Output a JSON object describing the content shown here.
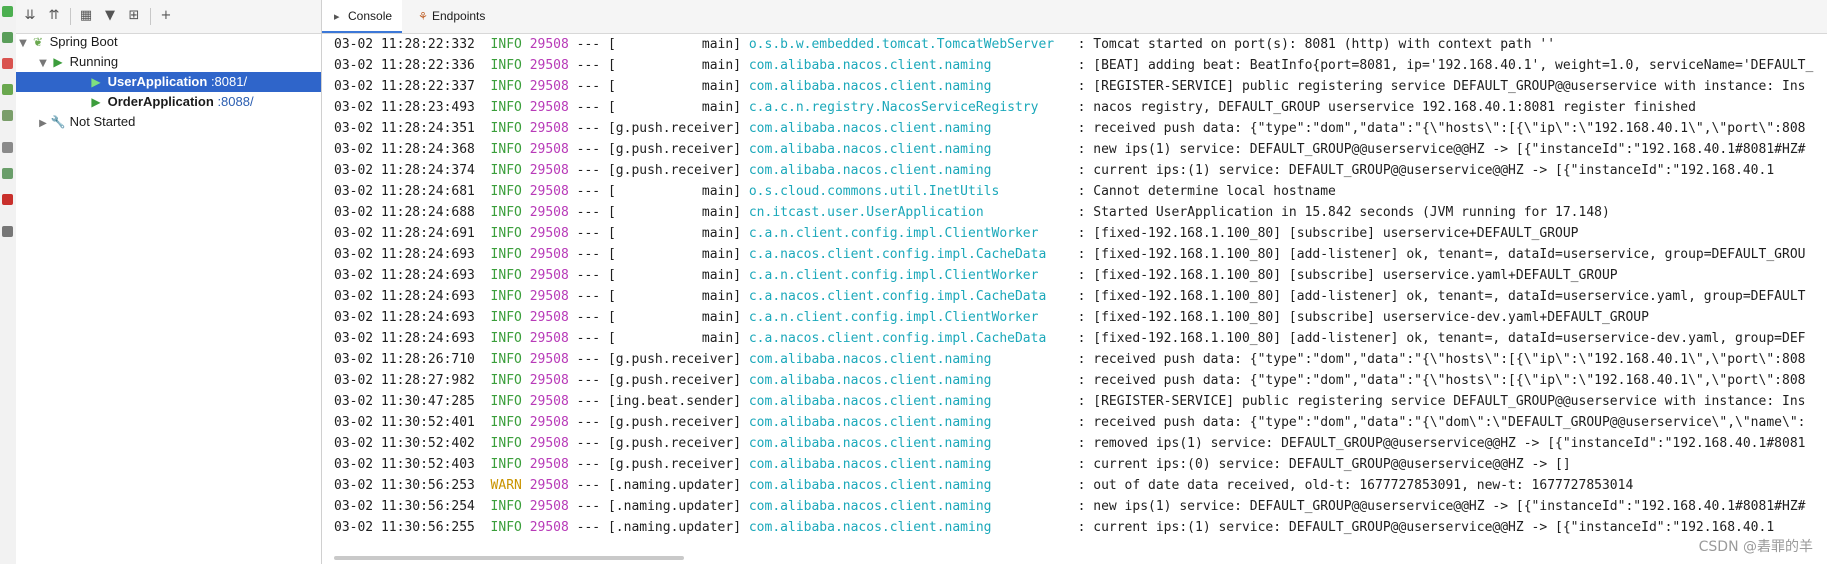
{
  "tree": {
    "root_label": "Spring Boot",
    "running_label": "Running",
    "apps": [
      {
        "name": "UserApplication",
        "port": ":8081/"
      },
      {
        "name": "OrderApplication",
        "port": ":8088/"
      }
    ],
    "not_started_label": "Not Started"
  },
  "tabs": {
    "console": "Console",
    "endpoints": "Endpoints"
  },
  "log": [
    {
      "ts": "03-02 11:28:22:332",
      "level": "INFO",
      "pid": "29508",
      "thread": "[           main]",
      "logger": "o.s.b.w.embedded.tomcat.TomcatWebServer  ",
      "msg": ": Tomcat started on port(s): 8081 (http) with context path ''"
    },
    {
      "ts": "03-02 11:28:22:336",
      "level": "INFO",
      "pid": "29508",
      "thread": "[           main]",
      "logger": "com.alibaba.nacos.client.naming          ",
      "msg": ": [BEAT] adding beat: BeatInfo{port=8081, ip='192.168.40.1', weight=1.0, serviceName='DEFAULT_"
    },
    {
      "ts": "03-02 11:28:22:337",
      "level": "INFO",
      "pid": "29508",
      "thread": "[           main]",
      "logger": "com.alibaba.nacos.client.naming          ",
      "msg": ": [REGISTER-SERVICE] public registering service DEFAULT_GROUP@@userservice with instance: Ins"
    },
    {
      "ts": "03-02 11:28:23:493",
      "level": "INFO",
      "pid": "29508",
      "thread": "[           main]",
      "logger": "c.a.c.n.registry.NacosServiceRegistry    ",
      "msg": ": nacos registry, DEFAULT_GROUP userservice 192.168.40.1:8081 register finished"
    },
    {
      "ts": "03-02 11:28:24:351",
      "level": "INFO",
      "pid": "29508",
      "thread": "[g.push.receiver]",
      "logger": "com.alibaba.nacos.client.naming          ",
      "msg": ": received push data: {\"type\":\"dom\",\"data\":\"{\\\"hosts\\\":[{\\\"ip\\\":\\\"192.168.40.1\\\",\\\"port\\\":808"
    },
    {
      "ts": "03-02 11:28:24:368",
      "level": "INFO",
      "pid": "29508",
      "thread": "[g.push.receiver]",
      "logger": "com.alibaba.nacos.client.naming          ",
      "msg": ": new ips(1) service: DEFAULT_GROUP@@userservice@@HZ -> [{\"instanceId\":\"192.168.40.1#8081#HZ#"
    },
    {
      "ts": "03-02 11:28:24:374",
      "level": "INFO",
      "pid": "29508",
      "thread": "[g.push.receiver]",
      "logger": "com.alibaba.nacos.client.naming          ",
      "msg": ": current ips:(1) service: DEFAULT_GROUP@@userservice@@HZ -> [{\"instanceId\":\"192.168.40.1"
    },
    {
      "ts": "03-02 11:28:24:681",
      "level": "INFO",
      "pid": "29508",
      "thread": "[           main]",
      "logger": "o.s.cloud.commons.util.InetUtils         ",
      "msg": ": Cannot determine local hostname"
    },
    {
      "ts": "03-02 11:28:24:688",
      "level": "INFO",
      "pid": "29508",
      "thread": "[           main]",
      "logger": "cn.itcast.user.UserApplication           ",
      "msg": ": Started UserApplication in 15.842 seconds (JVM running for 17.148)"
    },
    {
      "ts": "03-02 11:28:24:691",
      "level": "INFO",
      "pid": "29508",
      "thread": "[           main]",
      "logger": "c.a.n.client.config.impl.ClientWorker    ",
      "msg": ": [fixed-192.168.1.100_80] [subscribe] userservice+DEFAULT_GROUP"
    },
    {
      "ts": "03-02 11:28:24:693",
      "level": "INFO",
      "pid": "29508",
      "thread": "[           main]",
      "logger": "c.a.nacos.client.config.impl.CacheData   ",
      "msg": ": [fixed-192.168.1.100_80] [add-listener] ok, tenant=, dataId=userservice, group=DEFAULT_GROU"
    },
    {
      "ts": "03-02 11:28:24:693",
      "level": "INFO",
      "pid": "29508",
      "thread": "[           main]",
      "logger": "c.a.n.client.config.impl.ClientWorker    ",
      "msg": ": [fixed-192.168.1.100_80] [subscribe] userservice.yaml+DEFAULT_GROUP"
    },
    {
      "ts": "03-02 11:28:24:693",
      "level": "INFO",
      "pid": "29508",
      "thread": "[           main]",
      "logger": "c.a.nacos.client.config.impl.CacheData   ",
      "msg": ": [fixed-192.168.1.100_80] [add-listener] ok, tenant=, dataId=userservice.yaml, group=DEFAULT"
    },
    {
      "ts": "03-02 11:28:24:693",
      "level": "INFO",
      "pid": "29508",
      "thread": "[           main]",
      "logger": "c.a.n.client.config.impl.ClientWorker    ",
      "msg": ": [fixed-192.168.1.100_80] [subscribe] userservice-dev.yaml+DEFAULT_GROUP"
    },
    {
      "ts": "03-02 11:28:24:693",
      "level": "INFO",
      "pid": "29508",
      "thread": "[           main]",
      "logger": "c.a.nacos.client.config.impl.CacheData   ",
      "msg": ": [fixed-192.168.1.100_80] [add-listener] ok, tenant=, dataId=userservice-dev.yaml, group=DEF"
    },
    {
      "ts": "03-02 11:28:26:710",
      "level": "INFO",
      "pid": "29508",
      "thread": "[g.push.receiver]",
      "logger": "com.alibaba.nacos.client.naming          ",
      "msg": ": received push data: {\"type\":\"dom\",\"data\":\"{\\\"hosts\\\":[{\\\"ip\\\":\\\"192.168.40.1\\\",\\\"port\\\":808"
    },
    {
      "ts": "03-02 11:28:27:982",
      "level": "INFO",
      "pid": "29508",
      "thread": "[g.push.receiver]",
      "logger": "com.alibaba.nacos.client.naming          ",
      "msg": ": received push data: {\"type\":\"dom\",\"data\":\"{\\\"hosts\\\":[{\\\"ip\\\":\\\"192.168.40.1\\\",\\\"port\\\":808"
    },
    {
      "ts": "03-02 11:30:47:285",
      "level": "INFO",
      "pid": "29508",
      "thread": "[ing.beat.sender]",
      "logger": "com.alibaba.nacos.client.naming          ",
      "msg": ": [REGISTER-SERVICE] public registering service DEFAULT_GROUP@@userservice with instance: Ins"
    },
    {
      "ts": "03-02 11:30:52:401",
      "level": "INFO",
      "pid": "29508",
      "thread": "[g.push.receiver]",
      "logger": "com.alibaba.nacos.client.naming          ",
      "msg": ": received push data: {\"type\":\"dom\",\"data\":\"{\\\"dom\\\":\\\"DEFAULT_GROUP@@userservice\\\",\\\"name\\\":"
    },
    {
      "ts": "03-02 11:30:52:402",
      "level": "INFO",
      "pid": "29508",
      "thread": "[g.push.receiver]",
      "logger": "com.alibaba.nacos.client.naming          ",
      "msg": ": removed ips(1) service: DEFAULT_GROUP@@userservice@@HZ -> [{\"instanceId\":\"192.168.40.1#8081"
    },
    {
      "ts": "03-02 11:30:52:403",
      "level": "INFO",
      "pid": "29508",
      "thread": "[g.push.receiver]",
      "logger": "com.alibaba.nacos.client.naming          ",
      "msg": ": current ips:(0) service: DEFAULT_GROUP@@userservice@@HZ -> []"
    },
    {
      "ts": "03-02 11:30:56:253",
      "level": "WARN",
      "pid": "29508",
      "thread": "[.naming.updater]",
      "logger": "com.alibaba.nacos.client.naming          ",
      "msg": ": out of date data received, old-t: 1677727853091, new-t: 1677727853014"
    },
    {
      "ts": "03-02 11:30:56:254",
      "level": "INFO",
      "pid": "29508",
      "thread": "[.naming.updater]",
      "logger": "com.alibaba.nacos.client.naming          ",
      "msg": ": new ips(1) service: DEFAULT_GROUP@@userservice@@HZ -> [{\"instanceId\":\"192.168.40.1#8081#HZ#"
    },
    {
      "ts": "03-02 11:30:56:255",
      "level": "INFO",
      "pid": "29508",
      "thread": "[.naming.updater]",
      "logger": "com.alibaba.nacos.client.naming          ",
      "msg": ": current ips:(1) service: DEFAULT_GROUP@@userservice@@HZ -> [{\"instanceId\":\"192.168.40.1"
    }
  ],
  "watermark": "CSDN @砉罪的羊",
  "icons": {
    "expand_all": "expand-all-icon",
    "collapse_all": "collapse-all-icon",
    "group": "group-icon",
    "filter": "filter-icon",
    "add_config": "add-configuration-icon",
    "add": "add-icon"
  },
  "colors": {
    "selected_bg": "#2f65ca",
    "info": "#3a9e3a",
    "warn": "#c99400",
    "pid": "#b83ab8",
    "logger": "#1ba8ba"
  }
}
